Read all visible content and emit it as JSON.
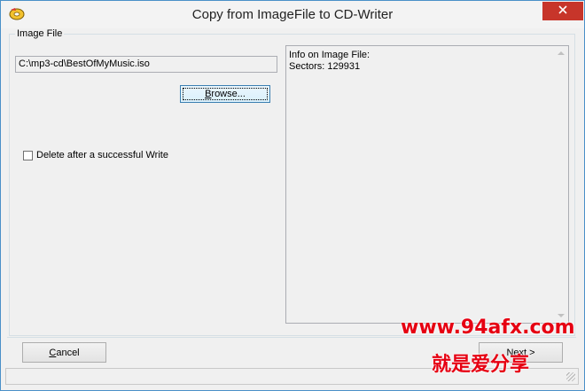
{
  "window": {
    "title": "Copy from ImageFile to CD-Writer",
    "app_icon": "cd-writer-icon",
    "close_icon": "close-icon",
    "accent_color": "#c7352a"
  },
  "image_file": {
    "group_label": "Image File",
    "path_value": "C:\\mp3-cd\\BestOfMyMusic.iso",
    "browse_prefix": "B",
    "browse_rest": "rowse...",
    "delete_checkbox_label": "Delete after a successful Write",
    "delete_checked": false
  },
  "info": {
    "text": "Info on Image File:\nSectors: 129931"
  },
  "footer": {
    "cancel_prefix": "C",
    "cancel_rest": "ancel",
    "next_label": "Next >"
  },
  "watermark": {
    "url": "www.94afx.com",
    "slogan": "就是爱分享",
    "color": "#e60012"
  }
}
